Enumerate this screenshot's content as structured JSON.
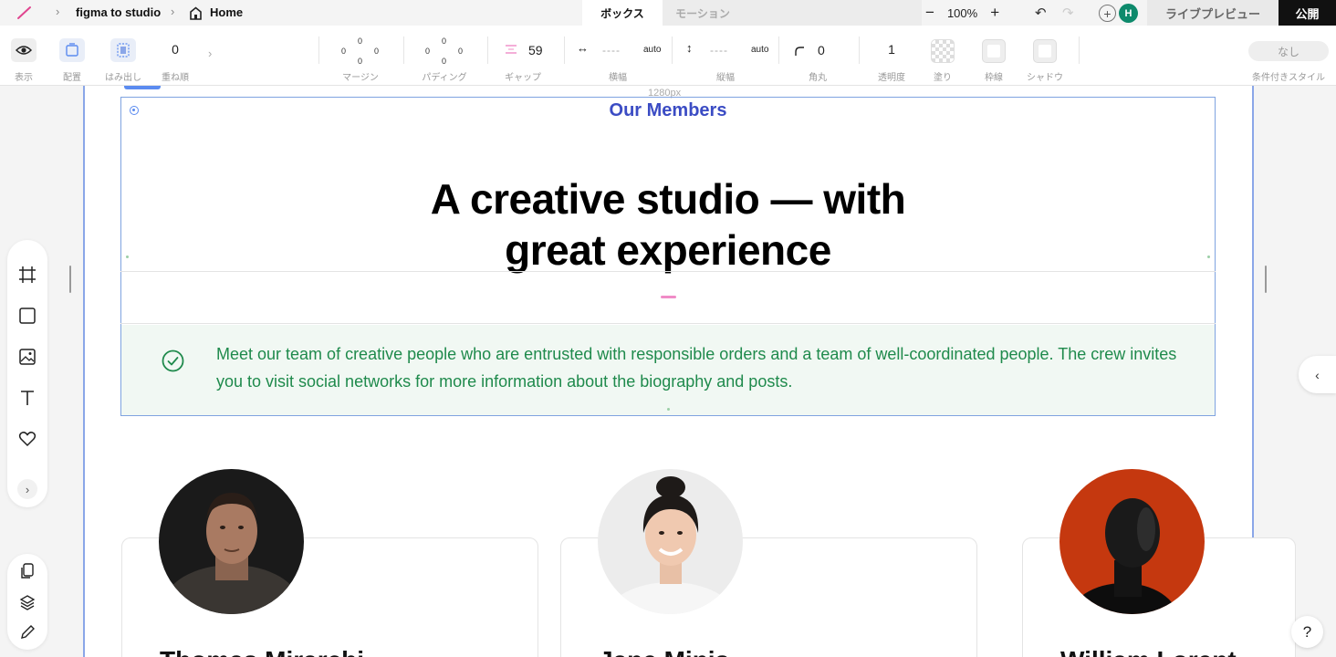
{
  "topbar": {
    "project": "figma to studio",
    "page": "Home",
    "tabs": [
      {
        "label": "ボックス",
        "active": true
      },
      {
        "label": "モーション",
        "active": false
      }
    ],
    "zoom": "100%",
    "avatar_initial": "H",
    "preview_label": "ライブプレビュー",
    "publish_label": "公開"
  },
  "props": {
    "show": "表示",
    "placement": "配置",
    "overflow": "はみ出し",
    "zindex_label": "重ね順",
    "zindex_value": "0",
    "margin_label": "マージン",
    "margin_values": [
      "0",
      "0",
      "0",
      "0"
    ],
    "padding_label": "パディング",
    "padding_values": [
      "0",
      "0",
      "0",
      "0"
    ],
    "gap_label": "ギャップ",
    "gap_value": "59",
    "width_label": "横幅",
    "width_value": "auto",
    "width_dash": "----",
    "height_label": "縦幅",
    "height_value": "auto",
    "height_dash": "----",
    "radius_label": "角丸",
    "radius_value": "0",
    "opacity_label": "透明度",
    "opacity_value": "1",
    "fill_label": "塗り",
    "border_label": "枠線",
    "shadow_label": "シャドウ",
    "conditional_label": "条件付きスタイル",
    "conditional_value": "なし"
  },
  "canvas": {
    "width_readout": "1280px",
    "eyebrow": "Our Members",
    "headline_line1": "A creative studio — with",
    "headline_line2": "great experience",
    "notice": "Meet our team of creative people who are entrusted with responsible orders and a team of well-coordinated people. The crew invites you to visit social networks for more information about the biography and posts.",
    "members": [
      {
        "name": "Thomas Mirarchi"
      },
      {
        "name": "Jane Minis"
      },
      {
        "name": "William Lorent"
      }
    ]
  },
  "colors": {
    "accent": "#3b4cc4",
    "notice_text": "#1f8a4c",
    "notice_bg": "#f1f8f3",
    "publish_bg": "#111111",
    "avatar_bg": "#0e8a6c"
  },
  "icons": {
    "logo": "pen-logo-icon",
    "home": "home-page-icon",
    "check": "check-circle-icon"
  }
}
